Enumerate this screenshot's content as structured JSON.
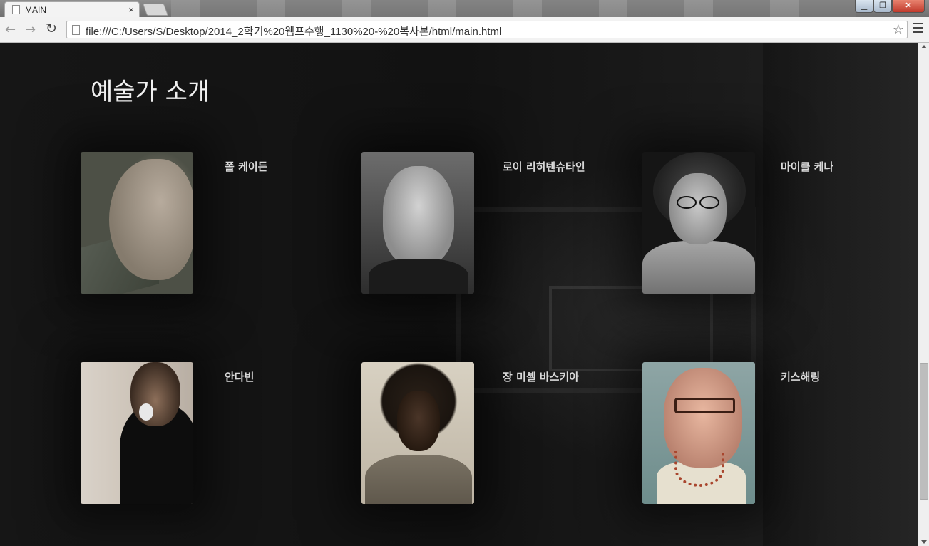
{
  "browser": {
    "tab_title": "MAIN",
    "tab_close": "×",
    "url": "file:///C:/Users/S/Desktop/2014_2학기%20웹프수행_1130%20-%20복사본/html/main.html",
    "back_glyph": "←",
    "forward_glyph": "→",
    "reload_glyph": "↻",
    "star_glyph": "☆",
    "window_controls": {
      "minimize": "▁",
      "maximize": "❐",
      "close": "✕"
    }
  },
  "page": {
    "title": "예술가 소개",
    "artists": [
      {
        "name": "폴 케이든",
        "photo_icon": "portrait-photo"
      },
      {
        "name": "로이 리히텐슈타인",
        "photo_icon": "portrait-photo"
      },
      {
        "name": "마이클 케나",
        "photo_icon": "portrait-photo"
      },
      {
        "name": "안다빈",
        "photo_icon": "portrait-photo"
      },
      {
        "name": "장 미셸 바스키아",
        "photo_icon": "portrait-photo"
      },
      {
        "name": "키스해링",
        "photo_icon": "portrait-photo"
      }
    ]
  },
  "colors": {
    "page_background": "#161616",
    "title_text": "#f2f2f2",
    "name_text": "#d8d8d8"
  }
}
